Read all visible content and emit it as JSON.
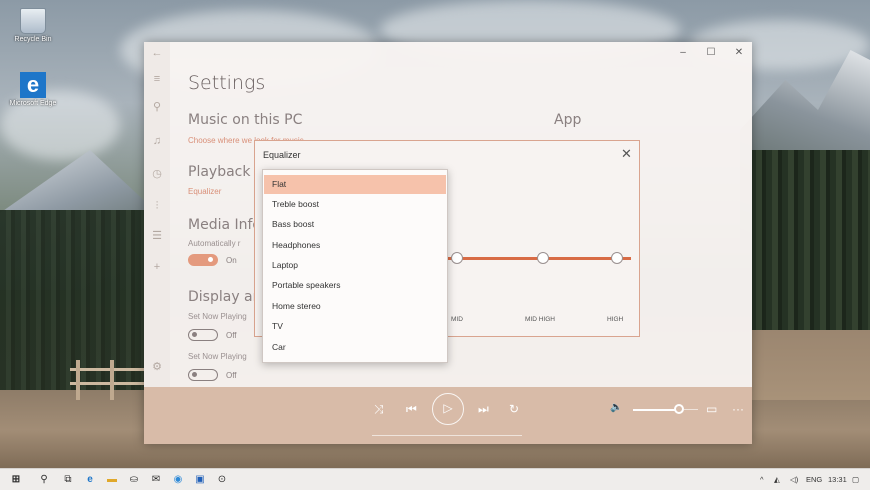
{
  "desktop": {
    "icons": [
      {
        "label": "Recycle Bin"
      },
      {
        "label": "Microsoft Edge"
      }
    ]
  },
  "window": {
    "controls": {
      "minimize": "–",
      "maximize": "☐",
      "close": "✕"
    },
    "nav_icons": [
      "back-icon",
      "hamburger-icon",
      "search-icon",
      "music-note-icon",
      "recent-icon",
      "chart-icon",
      "list-icon",
      "add-icon",
      "settings-icon"
    ]
  },
  "settings": {
    "title": "Settings",
    "music_section": "Music on this PC",
    "music_link": "Choose where we look for music",
    "app_section": "App",
    "playback_section": "Playback",
    "equalizer_link": "Equalizer",
    "media_info_section": "Media Info",
    "media_info_desc": "Automatically r",
    "media_info_toggle": "On",
    "display_art_section": "Display art",
    "now_playing_1": "Set Now Playing",
    "now_playing_1_toggle": "Off",
    "now_playing_2": "Set Now Playing",
    "now_playing_2_toggle": "Off"
  },
  "equalizer": {
    "title": "Equalizer",
    "close": "✕",
    "band_labels": [
      "MID",
      "MID HIGH",
      "HIGH"
    ],
    "presets": [
      "Flat",
      "Treble boost",
      "Bass boost",
      "Headphones",
      "Laptop",
      "Portable speakers",
      "Home stereo",
      "TV",
      "Car"
    ],
    "selected": "Flat"
  },
  "player": {
    "icons": [
      "shuffle-icon",
      "previous-icon",
      "play-icon",
      "next-icon",
      "repeat-icon",
      "volume-icon",
      "miniplayer-icon",
      "more-icon"
    ],
    "glyphs": {
      "shuffle": "⤨",
      "previous": "⏮",
      "play": "▷",
      "next": "⏭",
      "repeat": "↻",
      "volume": "🔈",
      "mini": "▭",
      "more": "···"
    },
    "volume_level": 0.85
  },
  "taskbar": {
    "tray_lang": "ENG",
    "tray_time": "13:31",
    "tray_up": "^"
  }
}
